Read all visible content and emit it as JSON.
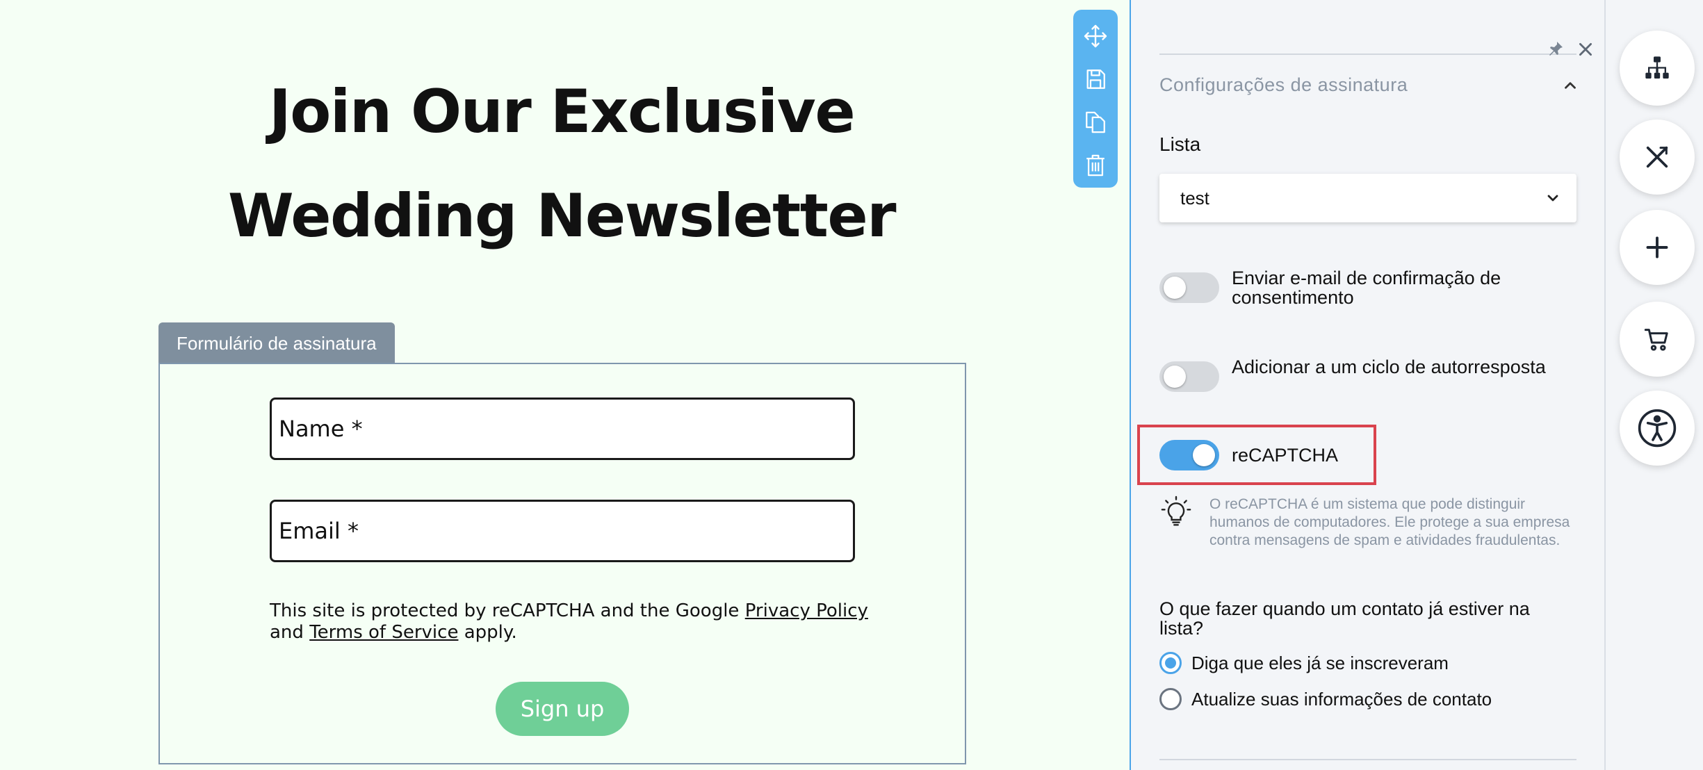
{
  "canvas": {
    "headline_line1": "Join Our Exclusive",
    "headline_line2": "Wedding Newsletter",
    "form_tab": "Formulário de assinatura",
    "name_placeholder": "Name *",
    "email_placeholder": "Email *",
    "protect_prefix": "This site is protected by reCAPTCHA and the Google ",
    "privacy_link": "Privacy Policy",
    "protect_and": "and ",
    "terms_link": "Terms of Service",
    "protect_suffix": " apply.",
    "signup_label": "Sign up"
  },
  "toolbar": {
    "icons": [
      "move-icon",
      "save-icon",
      "duplicate-icon",
      "delete-icon"
    ]
  },
  "panel": {
    "section_title": "Configurações de assinatura",
    "lista_label": "Lista",
    "lista_value": "test",
    "toggles": [
      {
        "label": "Enviar e-mail de confirmação de consentimento",
        "on": false
      },
      {
        "label": "Adicionar a um ciclo de autorresposta",
        "on": false
      },
      {
        "label": "reCAPTCHA",
        "on": true
      }
    ],
    "recaptcha_help": "O reCAPTCHA é um sistema que pode distinguir humanos de computadores. Ele protege a sua empresa contra mensagens de spam e atividades fraudulentas.",
    "question": "O que fazer quando um contato já estiver na lista?",
    "radio_options": [
      {
        "label": "Diga que eles já se inscreveram",
        "checked": true
      },
      {
        "label": "Atualize suas informações de contato",
        "checked": false
      }
    ]
  },
  "rail": {
    "icons": [
      "sitemap-icon",
      "tools-icon",
      "add-icon",
      "cart-icon",
      "accessibility-icon"
    ]
  },
  "colors": {
    "canvas_bg": "#f5fff5",
    "accent": "#4aa3e8",
    "signup_button": "#6fcf97",
    "highlight": "#d9434e",
    "form_tab": "#7f8f9e"
  }
}
